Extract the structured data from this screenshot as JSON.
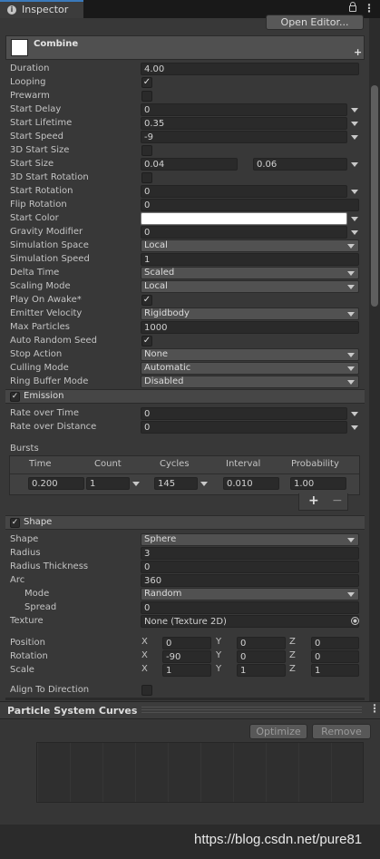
{
  "tab": {
    "title": "Inspector"
  },
  "header": {
    "open_editor": "Open Editor...",
    "system_name": "Combine",
    "add": "+"
  },
  "main": [
    {
      "label": "Duration",
      "type": "text",
      "value": "4.00"
    },
    {
      "label": "Looping",
      "type": "check",
      "checked": true
    },
    {
      "label": "Prewarm",
      "type": "check",
      "checked": false
    },
    {
      "label": "Start Delay",
      "type": "text",
      "value": "0",
      "arrow": true
    },
    {
      "label": "Start Lifetime",
      "type": "text",
      "value": "0.35",
      "arrow": true
    },
    {
      "label": "Start Speed",
      "type": "text",
      "value": "-9",
      "arrow": true
    },
    {
      "label": "3D Start Size",
      "type": "check",
      "checked": false
    },
    {
      "label": "Start Size",
      "type": "pair",
      "value": "0.04",
      "value2": "0.06",
      "arrow": true
    },
    {
      "label": "3D Start Rotation",
      "type": "check",
      "checked": false
    },
    {
      "label": "Start Rotation",
      "type": "text",
      "value": "0",
      "arrow": true
    },
    {
      "label": "Flip Rotation",
      "type": "text",
      "value": "0"
    },
    {
      "label": "Start Color",
      "type": "color",
      "value": "#FFFFFF",
      "arrow": true
    },
    {
      "label": "Gravity Modifier",
      "type": "text",
      "value": "0",
      "arrow": true
    },
    {
      "label": "Simulation Space",
      "type": "dropdown",
      "value": "Local"
    },
    {
      "label": "Simulation Speed",
      "type": "text",
      "value": "1"
    },
    {
      "label": "Delta Time",
      "type": "dropdown",
      "value": "Scaled"
    },
    {
      "label": "Scaling Mode",
      "type": "dropdown",
      "value": "Local"
    },
    {
      "label": "Play On Awake*",
      "type": "check",
      "checked": true
    },
    {
      "label": "Emitter Velocity",
      "type": "dropdown",
      "value": "Rigidbody"
    },
    {
      "label": "Max Particles",
      "type": "text",
      "value": "1000"
    },
    {
      "label": "Auto Random Seed",
      "type": "check",
      "checked": true
    },
    {
      "label": "Stop Action",
      "type": "dropdown",
      "value": "None"
    },
    {
      "label": "Culling Mode",
      "type": "dropdown",
      "value": "Automatic"
    },
    {
      "label": "Ring Buffer Mode",
      "type": "dropdown",
      "value": "Disabled"
    }
  ],
  "emission": {
    "title": "Emission",
    "enabled": true,
    "rows": [
      {
        "label": "Rate over Time",
        "type": "text",
        "value": "0",
        "arrow": true
      },
      {
        "label": "Rate over Distance",
        "type": "text",
        "value": "0",
        "arrow": true
      }
    ],
    "bursts": {
      "label": "Bursts",
      "headers": [
        "Time",
        "Count",
        "Cycles",
        "Interval",
        "Probability"
      ],
      "row": [
        "0.200",
        "1",
        "145",
        "0.010",
        "1.00"
      ],
      "add": "+",
      "remove": "−"
    }
  },
  "shape": {
    "title": "Shape",
    "enabled": true,
    "rows": [
      {
        "label": "Shape",
        "type": "dropdown",
        "value": "Sphere"
      },
      {
        "label": "Radius",
        "type": "text",
        "value": "3"
      },
      {
        "label": "Radius Thickness",
        "type": "text",
        "value": "0"
      },
      {
        "label": "Arc",
        "type": "text",
        "value": "360"
      },
      {
        "label": "Mode",
        "type": "dropdown",
        "value": "Random",
        "indent": true
      },
      {
        "label": "Spread",
        "type": "text",
        "value": "0",
        "indent": true
      },
      {
        "label": "Texture",
        "type": "object",
        "value": "None (Texture 2D)"
      }
    ],
    "transforms": [
      {
        "label": "Position",
        "x": "0",
        "y": "0",
        "z": "0"
      },
      {
        "label": "Rotation",
        "x": "-90",
        "y": "0",
        "z": "0"
      },
      {
        "label": "Scale",
        "x": "1",
        "y": "1",
        "z": "1"
      }
    ],
    "axes": [
      "X",
      "Y",
      "Z"
    ],
    "align": {
      "label": "Align To Direction",
      "checked": false
    }
  },
  "curves": {
    "title": "Particle System Curves",
    "optimize": "Optimize",
    "remove": "Remove"
  },
  "watermark": "https://blog.csdn.net/pure81"
}
